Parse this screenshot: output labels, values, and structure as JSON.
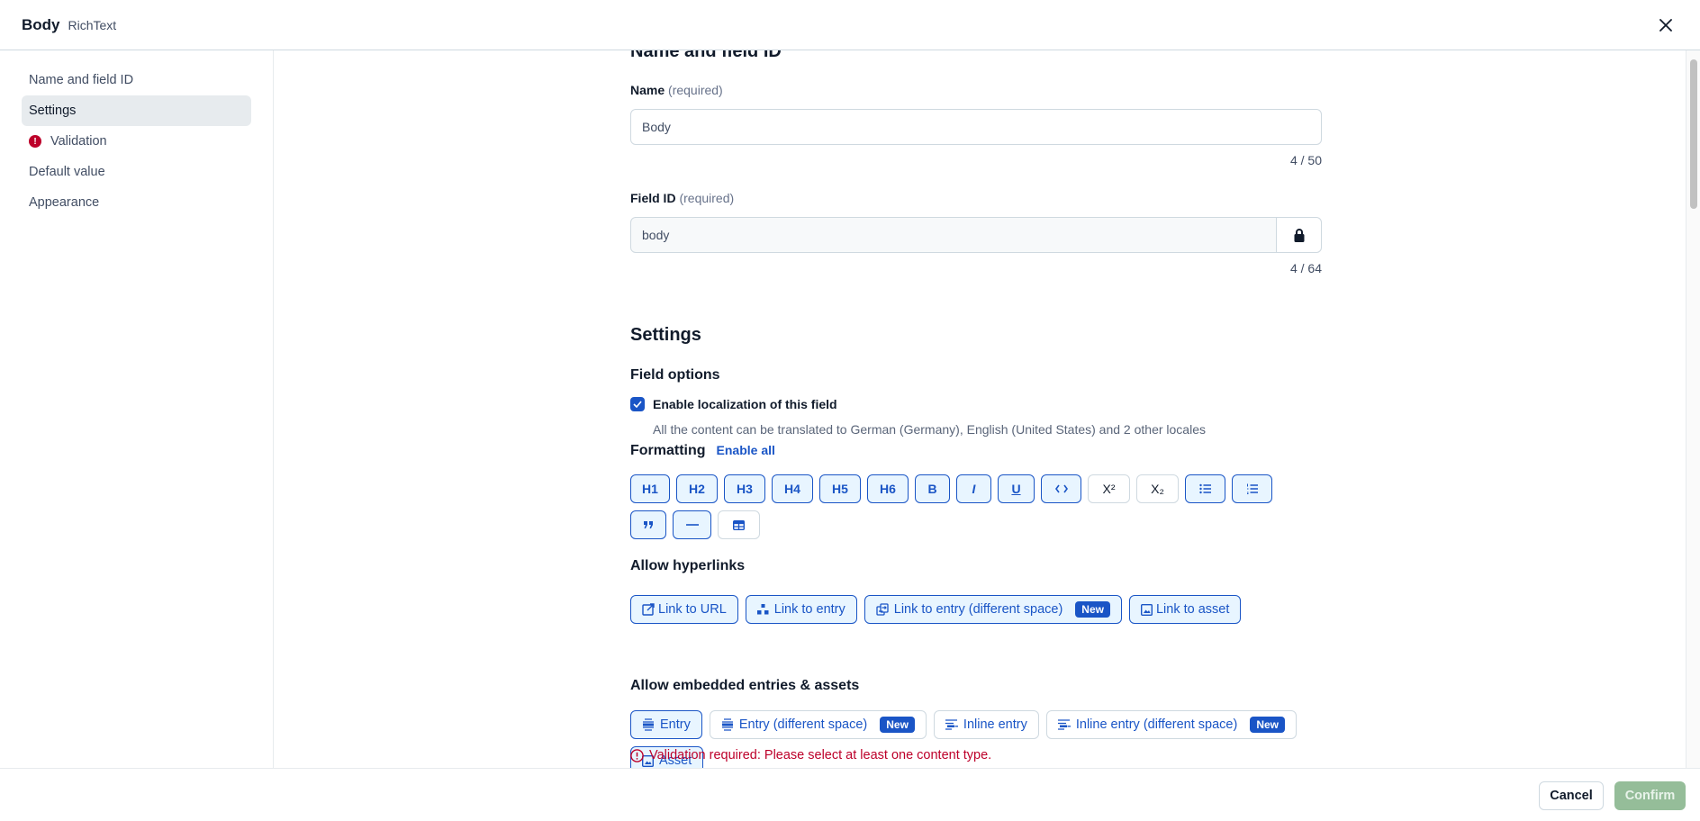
{
  "header": {
    "title": "Body",
    "subtitle": "RichText"
  },
  "sidebar": {
    "items": [
      {
        "label": "Name and field ID",
        "active": false,
        "error": false
      },
      {
        "label": "Settings",
        "active": true,
        "error": false
      },
      {
        "label": "Validation",
        "active": false,
        "error": true
      },
      {
        "label": "Default value",
        "active": false,
        "error": false
      },
      {
        "label": "Appearance",
        "active": false,
        "error": false
      }
    ]
  },
  "name_section": {
    "heading": "Name and field ID",
    "name_label": "Name",
    "name_required": "(required)",
    "name_value": "Body",
    "name_counter": "4 / 50",
    "field_id_label": "Field ID",
    "field_id_required": "(required)",
    "field_id_value": "body",
    "field_id_counter": "4 / 64"
  },
  "settings": {
    "heading": "Settings",
    "field_options_heading": "Field options",
    "localization_label": "Enable localization of this field",
    "localization_checked": true,
    "localization_help": "All the content can be translated to German (Germany), English (United States) and 2 other locales",
    "formatting_heading": "Formatting",
    "enable_all": "Enable all",
    "formatting_buttons": [
      {
        "label": "H1",
        "enabled": true
      },
      {
        "label": "H2",
        "enabled": true
      },
      {
        "label": "H3",
        "enabled": true
      },
      {
        "label": "H4",
        "enabled": true
      },
      {
        "label": "H5",
        "enabled": true
      },
      {
        "label": "H6",
        "enabled": true
      },
      {
        "label": "B",
        "icon": "bold-icon",
        "enabled": true
      },
      {
        "label": "I",
        "icon": "italic-icon",
        "enabled": true
      },
      {
        "label": "U",
        "icon": "underline-icon",
        "enabled": true
      },
      {
        "label": "<>",
        "icon": "code-icon",
        "enabled": true
      },
      {
        "label": "X²",
        "icon": "superscript-icon",
        "enabled": false
      },
      {
        "label": "X₂",
        "icon": "subscript-icon",
        "enabled": false
      },
      {
        "label": "",
        "icon": "bulleted-list-icon",
        "enabled": true
      },
      {
        "label": "",
        "icon": "numbered-list-icon",
        "enabled": true
      },
      {
        "label": "",
        "icon": "quote-icon",
        "enabled": true
      },
      {
        "label": "",
        "icon": "horizontal-rule-icon",
        "enabled": true
      },
      {
        "label": "",
        "icon": "table-icon",
        "enabled": false
      }
    ],
    "hyperlinks_heading": "Allow hyperlinks",
    "hyperlinks": [
      {
        "label": "Link to URL",
        "icon": "external-link-icon",
        "enabled": true
      },
      {
        "label": "Link to entry",
        "icon": "entry-link-icon",
        "enabled": true
      },
      {
        "label": "Link to entry (different space)",
        "icon": "cross-space-link-icon",
        "enabled": true,
        "badge": "New"
      },
      {
        "label": "Link to asset",
        "icon": "asset-icon",
        "enabled": true
      }
    ],
    "embedded_heading": "Allow embedded entries & assets",
    "embedded": [
      {
        "label": "Entry",
        "icon": "entry-block-icon",
        "enabled": true
      },
      {
        "label": "Entry (different space)",
        "icon": "entry-block-icon",
        "enabled": false,
        "badge": "New"
      },
      {
        "label": "Inline entry",
        "icon": "inline-entry-icon",
        "enabled": false
      },
      {
        "label": "Inline entry (different space)",
        "icon": "inline-entry-icon",
        "enabled": false,
        "badge": "New"
      },
      {
        "label": "Asset",
        "icon": "asset-icon",
        "enabled": true
      }
    ],
    "validation_error": "Validation required: Please select at least one content type."
  },
  "footer": {
    "cancel": "Cancel",
    "confirm": "Confirm"
  },
  "colors": {
    "accent": "#1a55c6",
    "error": "#bd002a",
    "confirm_disabled": "#95bd99",
    "selected_bg": "#e8f5ff"
  }
}
